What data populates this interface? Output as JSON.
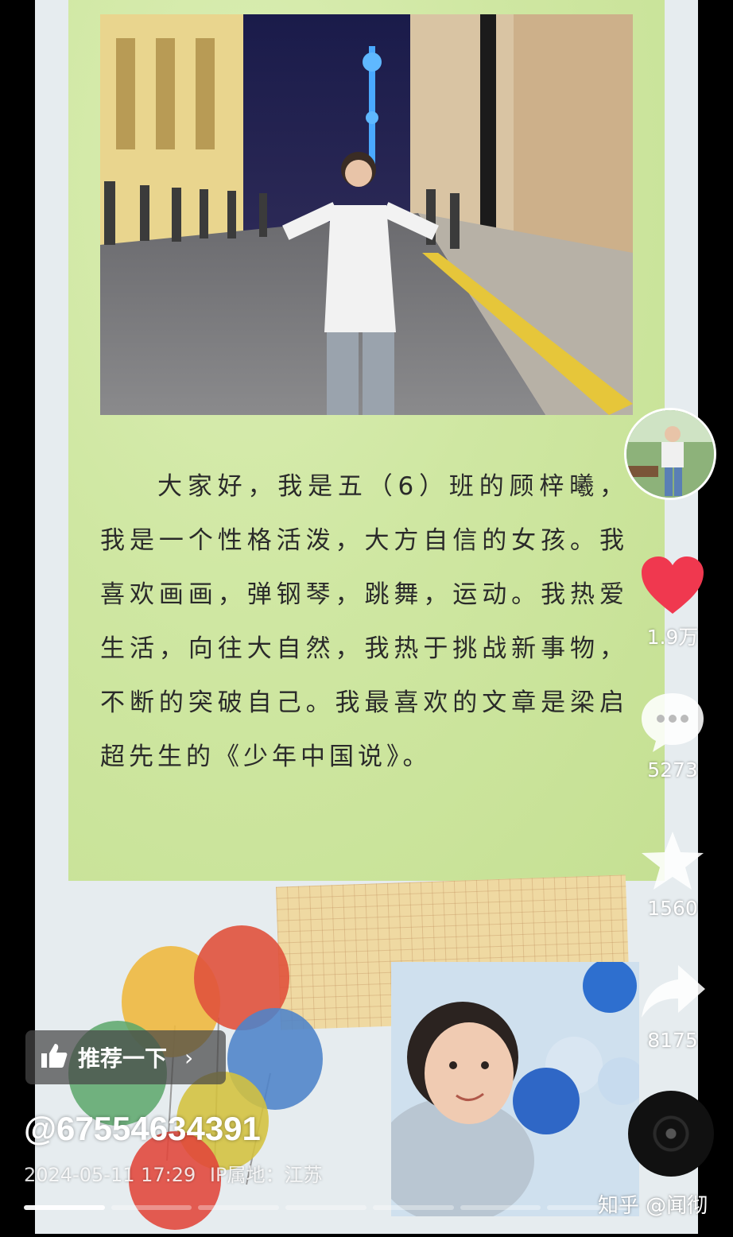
{
  "post": {
    "intro_text": "大家好，我是五（6）班的顾梓曦，我是一个性格活泼，大方自信的女孩。我喜欢画画，弹钢琴，跳舞，运动。我热爱生活，向往大自然，我热于挑战新事物，不断的突破自己。我最喜欢的文章是梁启超先生的《少年中国说》。",
    "username": "@67554634391",
    "date": "2024-05-11 17:29",
    "ip_location": "IP属地：江苏"
  },
  "actions": {
    "like_count": "1.9万",
    "comment_count": "5273",
    "favorite_count": "1560",
    "share_count": "8175"
  },
  "recommend": {
    "label": "推荐一下",
    "chevron": "›"
  },
  "watermark": "知乎 @闻彻",
  "colors": {
    "like_red": "#f0384f",
    "panel_green": "#cfe7a2",
    "grid_paper": "#efd9a2"
  },
  "icons": [
    "thumbs-up-icon",
    "heart-icon",
    "comment-icon",
    "star-icon",
    "share-icon",
    "music-disc-icon"
  ]
}
